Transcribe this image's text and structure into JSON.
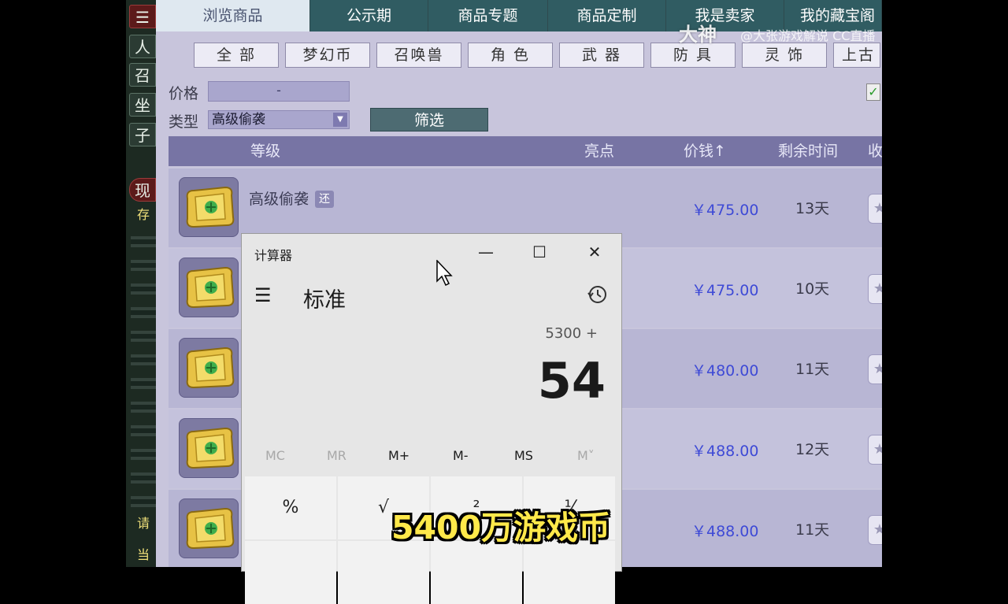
{
  "game_sidebar": {
    "buttons": [
      "人",
      "召",
      "坐",
      "子"
    ],
    "tags": [
      "现",
      "存",
      "请",
      "当"
    ]
  },
  "tabs": [
    {
      "label": "浏览商品",
      "active": true
    },
    {
      "label": "公示期",
      "active": false
    },
    {
      "label": "商品专题",
      "active": false
    },
    {
      "label": "商品定制",
      "active": false
    },
    {
      "label": "我是卖家",
      "active": false
    },
    {
      "label": "我的藏宝阁",
      "active": false
    }
  ],
  "categories": [
    "全 部",
    "梦幻币",
    "召唤兽",
    "角 色",
    "武 器",
    "防 具",
    "灵 饰",
    "上古"
  ],
  "filters": {
    "price_label": "价格",
    "price_range": "-",
    "type_label": "类型",
    "type_value": "高级偷袭",
    "filter_button": "筛选"
  },
  "table": {
    "headers": {
      "level": "等级",
      "highlight": "亮点",
      "price": "价钱↑",
      "remaining": "剩余时间",
      "fav": "收"
    },
    "rows": [
      {
        "name": "高级偷袭",
        "badge": "还",
        "price": "￥475.00",
        "days": "13天"
      },
      {
        "name": "",
        "badge": "",
        "price": "￥475.00",
        "days": "10天"
      },
      {
        "name": "",
        "badge": "",
        "price": "￥480.00",
        "days": "11天"
      },
      {
        "name": "",
        "badge": "",
        "price": "￥488.00",
        "days": "12天"
      },
      {
        "name": "",
        "badge": "",
        "price": "￥488.00",
        "days": "11天"
      }
    ]
  },
  "calculator": {
    "title": "计算器",
    "mode": "标准",
    "expression": "5300 +",
    "display": "54",
    "memory": [
      "MC",
      "MR",
      "M+",
      "M-",
      "MS",
      "M˅"
    ],
    "keys_row1": [
      "%",
      "√",
      "²",
      "⅟"
    ],
    "window_buttons": {
      "minimize": "—",
      "maximize": "☐",
      "close": "✕"
    }
  },
  "watermark": {
    "brand": "大神",
    "handle": "@大张游戏解说 CC直播"
  },
  "subtitle": "5400万游戏币",
  "colors": {
    "price": "#3e4ad6",
    "tab_bar": "#305c62",
    "subtitle": "#ffe94a"
  }
}
